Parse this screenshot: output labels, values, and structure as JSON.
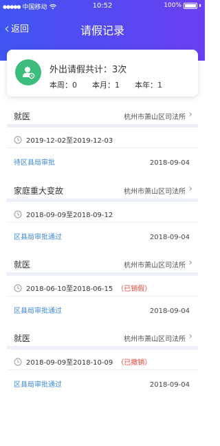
{
  "status_bar": {
    "carrier": "中国移动",
    "time": "10:52",
    "battery": "100%"
  },
  "nav": {
    "back_label": "返回",
    "title": "请假记录"
  },
  "summary": {
    "title": "外出请假共计：3次",
    "week": "本周：0",
    "month": "本月：1",
    "year": "本年：1"
  },
  "records": [
    {
      "type": "就医",
      "org": "杭州市萧山区司法所",
      "dates": "2019-12-02至2019-12-03",
      "flag": "",
      "status": "待区县局审批",
      "date": "2018-09-04"
    },
    {
      "type": "家庭重大变故",
      "org": "杭州市萧山区司法所",
      "dates": "2018-09-09至2018-09-12",
      "flag": "",
      "status": "区县局审批通过",
      "date": "2018-09-04"
    },
    {
      "type": "就医",
      "org": "杭州市萧山区司法所",
      "dates": "2018-06-10至2018-06-15",
      "flag": "（已销假）",
      "status": "区县局审批通过",
      "date": "2018-09-04"
    },
    {
      "type": "就医",
      "org": "杭州市萧山区司法所",
      "dates": "2018-09-09至2018-10-09",
      "flag": "（已撤销）",
      "status": "区县局审批通过",
      "date": "2018-09-04"
    }
  ],
  "colors": {
    "header_start": "#3f55f2",
    "header_end": "#6a3ff2",
    "status_blue": "#3f8bd8",
    "flag_red": "#e2473c",
    "avatar_green": "#3dbd7d"
  }
}
